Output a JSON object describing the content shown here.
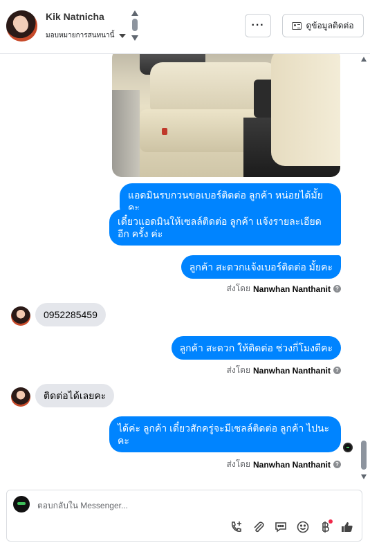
{
  "header": {
    "contact_name": "Kik Natnicha",
    "assign_label": "มอบหมายการสนทนานี้",
    "more_label": "···",
    "contact_info_label": "ดูข้อมูลติดต่อ"
  },
  "messages": {
    "out1": "แอดมินรบกวนขอเบอร์ติดต่อ ลูกค้า หน่อยได้มั้ยคะ",
    "out2": "เดี๋ยวแอดมินให้เซลล์ติดต่อ ลูกค้า แจ้งรายละเอียดอีก ครั้ง ค่ะ",
    "out3": "ลูกค้า สะดวกแจ้งเบอร์ติดต่อ มั้ยคะ",
    "in1": "0952285459",
    "out4": "ลูกค้า สะดวก ให้ติดต่อ ช่วงกี่โมงดีคะ",
    "in2": "ติดต่อได้เลยคะ",
    "out5": "ได้ค่ะ  ลูกค้า เดี๋ยวสักครู่จะมีเซลล์ติดต่อ ลูกค้า ไปนะ คะ"
  },
  "sent_by": {
    "prefix": "ส่งโดย",
    "name": "Nanwhan Nanthanit",
    "info_icon": "?"
  },
  "composer": {
    "placeholder": "ตอบกลับใน Messenger..."
  },
  "icons": {
    "more": "more-horizontal-icon",
    "contact_card": "contact-card-icon",
    "call": "call-add-icon",
    "attach": "paperclip-icon",
    "saved_reply": "saved-reply-icon",
    "emoji": "emoji-icon",
    "payment": "baht-icon",
    "like": "thumbs-up-icon"
  },
  "colors": {
    "outgoing": "#0084ff",
    "incoming": "#e4e6eb",
    "notification": "#f02849"
  }
}
